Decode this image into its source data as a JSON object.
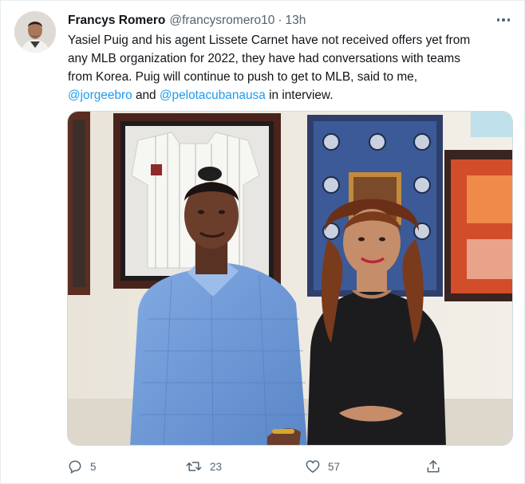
{
  "tweet": {
    "author_name": "Francys Romero",
    "handle": "@francysromero10",
    "separator": "·",
    "time": "13h",
    "text": {
      "line1": "Yasiel Puig and his agent Lissete Carnet have not received offers yet from",
      "line2": "any MLB organization for 2022, they have had conversations with teams",
      "line3": "from Korea. Puig will continue to push to get to MLB, said to me,",
      "mention1": "@jorgeebro",
      "and_word": "and",
      "mention2": "@pelotacubanausa",
      "ending": "in interview."
    }
  },
  "actions": {
    "replies": "5",
    "retweets": "23",
    "likes": "57"
  },
  "icons": {
    "reply": "reply-icon",
    "retweet": "retweet-icon",
    "like": "heart-icon",
    "share": "share-icon",
    "more": "more-icon"
  },
  "colors": {
    "link": "#1d9bf0",
    "secondary_text": "#536471",
    "primary_text": "#0f1419",
    "shirt_blue": "#6f9ad8",
    "dress_black": "#1c1c1e"
  }
}
